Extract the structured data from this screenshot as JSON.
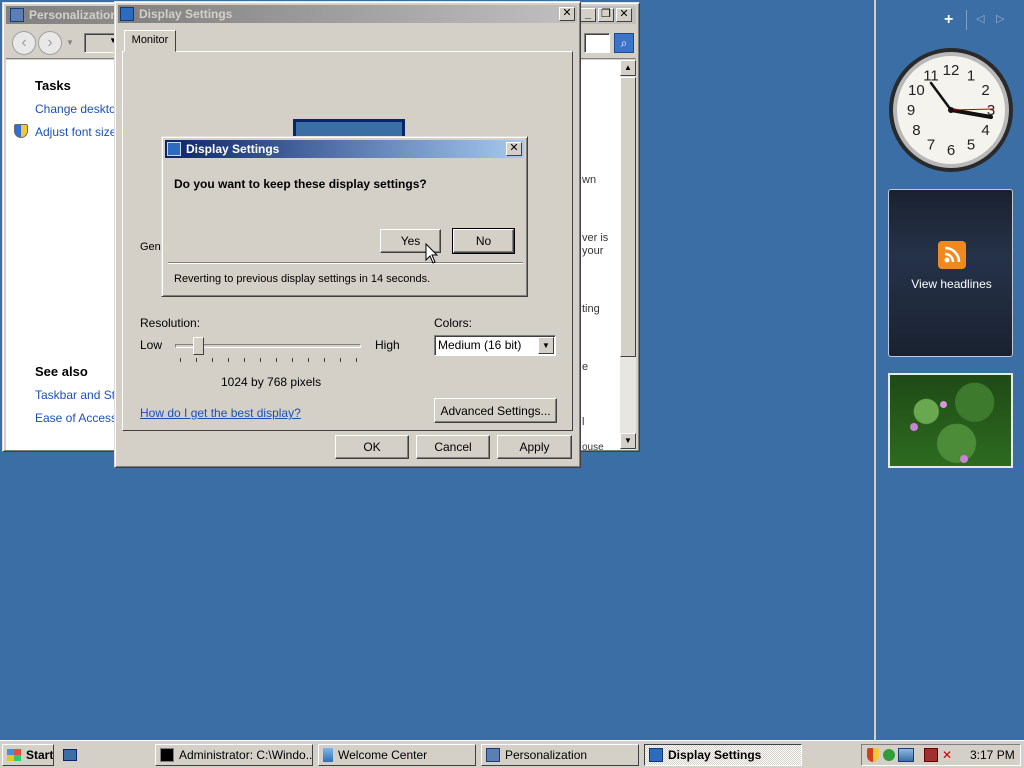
{
  "personalization": {
    "title": "Personalization",
    "tasks_heading": "Tasks",
    "task_links": [
      "Change desktop",
      "Adjust font size ("
    ],
    "see_also_heading": "See also",
    "see_also_links": [
      "Taskbar and Star",
      "Ease of Access"
    ],
    "right_snippets": [
      "wn",
      "ver is",
      "your",
      "ting",
      "e",
      "l",
      "ouse"
    ]
  },
  "display_settings": {
    "title": "Display Settings",
    "tab": "Monitor",
    "general_partial": "Gen",
    "resolution_label": "Resolution:",
    "low_label": "Low",
    "high_label": "High",
    "resolution_value": "1024 by 768 pixels",
    "resolution_fraction": 0.1,
    "colors_label": "Colors:",
    "colors_value": "Medium (16 bit)",
    "help_link": "How do I get the best display?",
    "advanced_button": "Advanced Settings...",
    "ok_button": "OK",
    "cancel_button": "Cancel",
    "apply_button": "Apply"
  },
  "confirm_dialog": {
    "title": "Display Settings",
    "question": "Do you want to keep these display settings?",
    "yes_button": "Yes",
    "no_button": "No",
    "countdown": "Reverting to previous display settings in 14 seconds."
  },
  "sidebar": {
    "feed_gadget_label": "View headlines",
    "clock_numbers": [
      "12",
      "1",
      "2",
      "3",
      "4",
      "5",
      "6",
      "7",
      "8",
      "9",
      "10",
      "11"
    ]
  },
  "taskbar": {
    "start_label": "Start",
    "tasks": [
      {
        "label": "Administrator: C:\\Windo...",
        "icon": "cmd-icon"
      },
      {
        "label": "Welcome Center",
        "icon": "welcome-icon"
      },
      {
        "label": "Personalization",
        "icon": "personalization-icon"
      },
      {
        "label": "Display Settings",
        "icon": "display-settings-icon"
      }
    ],
    "time": "3:17 PM"
  },
  "colors": {
    "desktop": "#3a6ea5",
    "link": "#1b50b8",
    "titlebar_active": "#0a246a"
  }
}
